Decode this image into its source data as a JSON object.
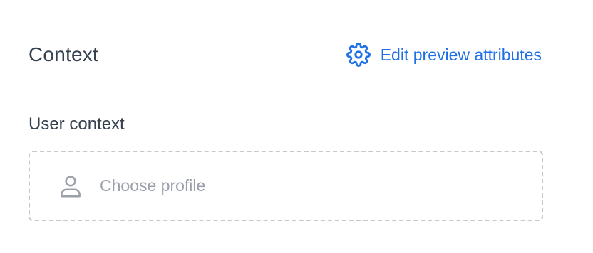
{
  "context": {
    "title": "Context",
    "edit_link_label": "Edit preview attributes",
    "edit_icon": "gear-icon",
    "accent_color": "#1f6fe5"
  },
  "user_context": {
    "label": "User context",
    "picker_placeholder": "Choose profile",
    "picker_icon": "user-icon"
  }
}
